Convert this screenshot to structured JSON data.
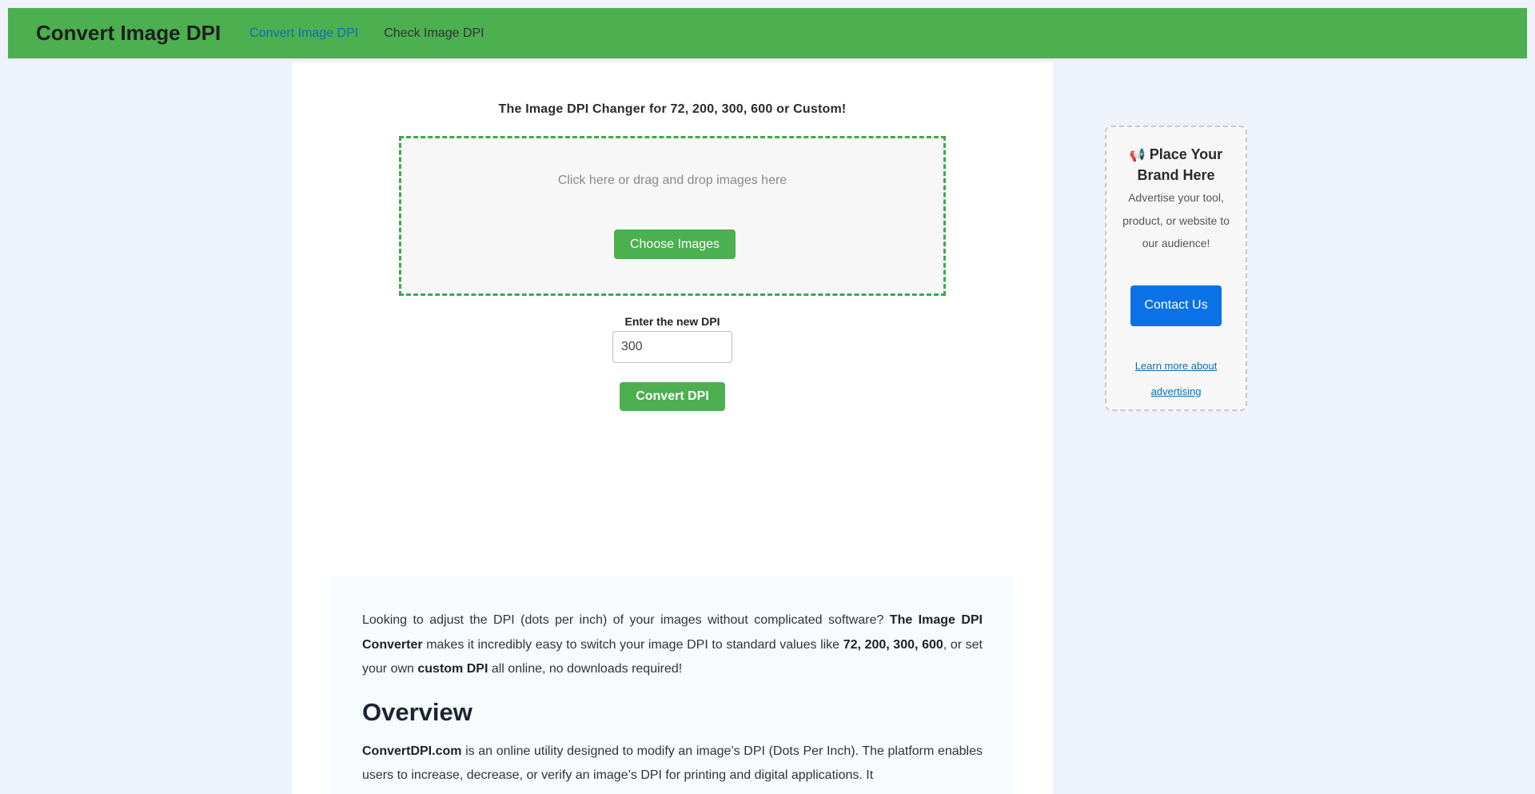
{
  "nav": {
    "brand": "Convert Image DPI",
    "links": [
      {
        "label": "Convert Image DPI",
        "active": true
      },
      {
        "label": "Check Image DPI",
        "active": false
      }
    ]
  },
  "converter": {
    "tagline": "The Image DPI Changer for 72, 200, 300, 600 or Custom!",
    "drop_text": "Click here or drag and drop images here",
    "choose_button": "Choose Images",
    "dpi_label": "Enter the new DPI",
    "dpi_value": "300",
    "convert_button": "Convert DPI"
  },
  "article": {
    "intro": [
      {
        "text": "Looking to adjust the DPI (dots per inch) of your images without complicated software? ",
        "bold": false
      },
      {
        "text": "The Image DPI Converter",
        "bold": true
      },
      {
        "text": " makes it incredibly easy to switch your image DPI to standard values like ",
        "bold": false
      },
      {
        "text": "72, 200, 300, 600",
        "bold": true
      },
      {
        "text": ", or set your own ",
        "bold": false
      },
      {
        "text": "custom DPI",
        "bold": true
      },
      {
        "text": " all online, no downloads required!",
        "bold": false
      }
    ],
    "overview_heading": "Overview",
    "overview": [
      {
        "text": "ConvertDPI.com",
        "bold": true
      },
      {
        "text": " is an online utility designed to modify an image’s DPI (Dots Per Inch). The platform enables users to increase, decrease, or verify an image’s DPI for printing and digital applications. It",
        "bold": false
      }
    ]
  },
  "ad": {
    "icon": "megaphone-icon",
    "title": "Place Your Brand Here",
    "description": "Advertise your tool, product, or website to our audience!",
    "contact_button": "Contact Us",
    "learn_more": "Learn more about advertising"
  },
  "colors": {
    "nav_green": "#4caf50",
    "button_green": "#4caf50",
    "contact_blue": "#0a72e6",
    "link_blue": "#0b6fb8",
    "page_bg": "#eef3fb"
  }
}
